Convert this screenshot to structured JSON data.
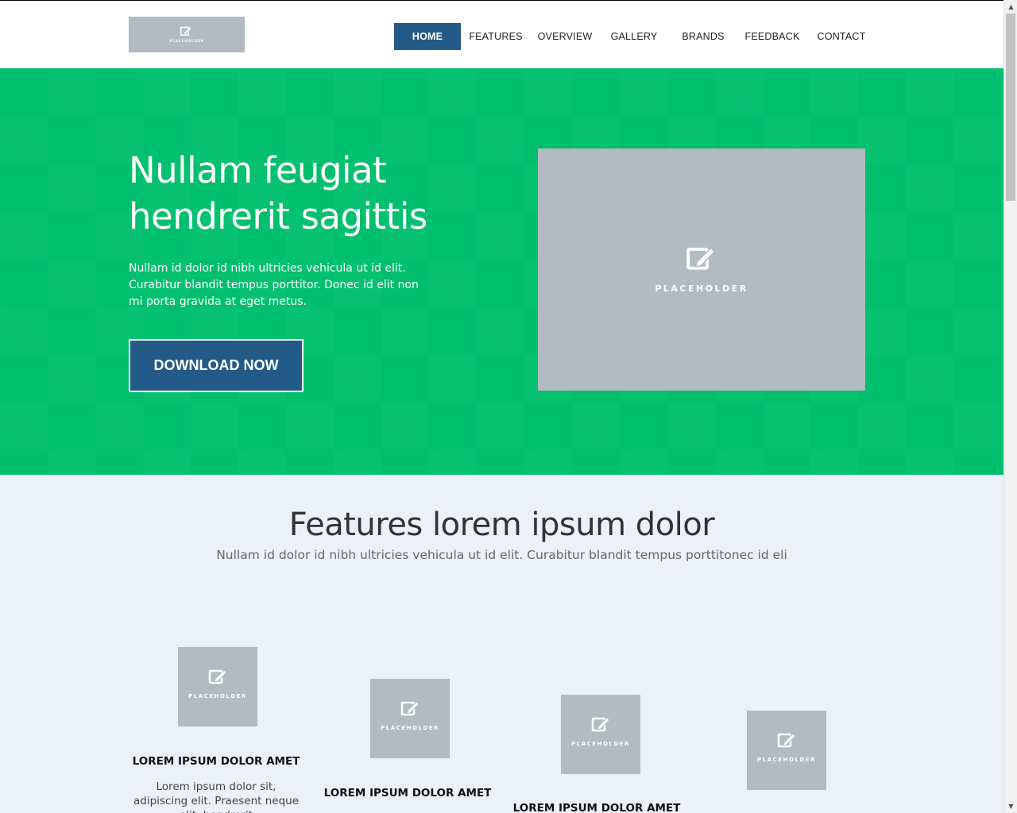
{
  "header": {
    "logo": {
      "placeholder_text": "PLACEHOLDER",
      "icon": "edit-icon"
    },
    "nav": [
      {
        "label": "HOME",
        "active": true
      },
      {
        "label": "FEATURES",
        "active": false
      },
      {
        "label": "OVERVIEW",
        "active": false
      },
      {
        "label": "GALLERY",
        "active": false
      },
      {
        "label": "BRANDS",
        "active": false
      },
      {
        "label": "FEEDBACK",
        "active": false
      },
      {
        "label": "CONTACT",
        "active": false
      }
    ]
  },
  "hero": {
    "title": "Nullam feugiat hendrerit sagittis",
    "text": "Nullam id dolor id nibh ultricies vehicula ut id elit. Curabitur blandit tempus porttitor.  Donec id elit non mi porta gravida at eget metus.",
    "button_label": "DOWNLOAD NOW",
    "image_placeholder": "PLACEHOLDER"
  },
  "features": {
    "title": "Features lorem ipsum dolor",
    "subtitle": "Nullam id dolor id nibh ultricies vehicula ut id elit. Curabitur blandit tempus porttitonec id eli",
    "items": [
      {
        "placeholder": "PLACEHOLDER",
        "title": "LOREM IPSUM DOLOR AMET",
        "text": "Lorem ipsum dolor sit, adipiscing elit. Praesent neque elit, hendrerit"
      },
      {
        "placeholder": "PLACEHOLDER",
        "title": "LOREM IPSUM DOLOR AMET"
      },
      {
        "placeholder": "PLACEHOLDER",
        "title": "LOREM IPSUM DOLOR AMET"
      },
      {
        "placeholder": "PLACEHOLDER"
      }
    ]
  },
  "colors": {
    "hero_bg": "#00bf6d",
    "accent_blue": "#245a87",
    "placeholder_gray": "#b2bbc0",
    "section_bg": "#ecf0f7"
  }
}
